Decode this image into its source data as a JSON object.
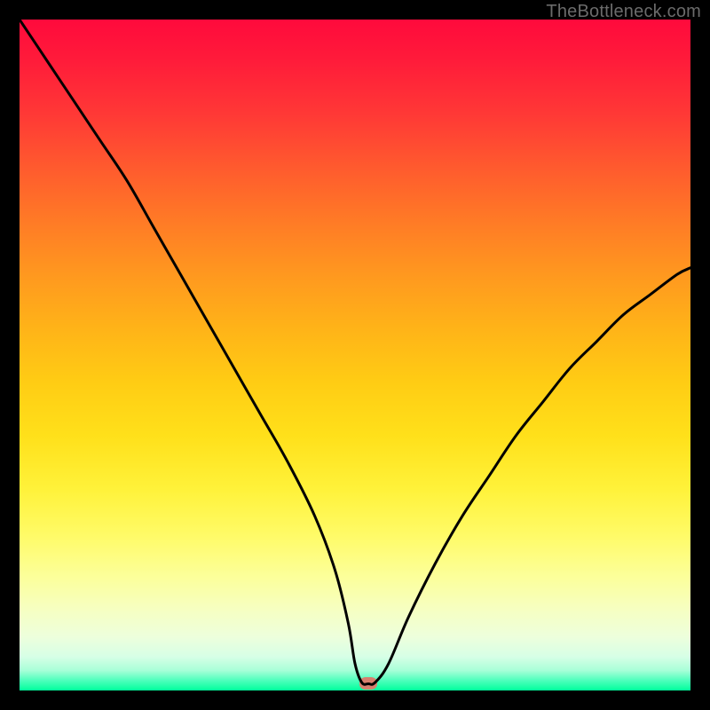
{
  "attribution": "TheBottleneck.com",
  "colors": {
    "frame": "#000000",
    "curve_stroke": "#000000",
    "marker_fill": "#d77f6e",
    "attribution_text": "#6b6b6b",
    "gradient_top": "#ff0a3c",
    "gradient_bottom": "#00ff9c"
  },
  "chart_data": {
    "type": "line",
    "title": "",
    "xlabel": "",
    "ylabel": "",
    "xlim": [
      0,
      100
    ],
    "ylim": [
      0,
      100
    ],
    "grid": false,
    "legend": false,
    "annotations": [],
    "marker": {
      "x": 52,
      "y": 1
    },
    "series": [
      {
        "name": "bottleneck-curve",
        "x": [
          0,
          4,
          8,
          12,
          16,
          20,
          24,
          28,
          32,
          36,
          40,
          44,
          47,
          49,
          50,
          51,
          52,
          53,
          55,
          58,
          62,
          66,
          70,
          74,
          78,
          82,
          86,
          90,
          94,
          98,
          100
        ],
        "y": [
          100,
          94,
          88,
          82,
          76,
          69,
          62,
          55,
          48,
          41,
          34,
          26,
          18,
          10,
          4,
          1.2,
          1,
          1.2,
          4,
          11,
          19,
          26,
          32,
          38,
          43,
          48,
          52,
          56,
          59,
          62,
          63
        ]
      }
    ]
  }
}
